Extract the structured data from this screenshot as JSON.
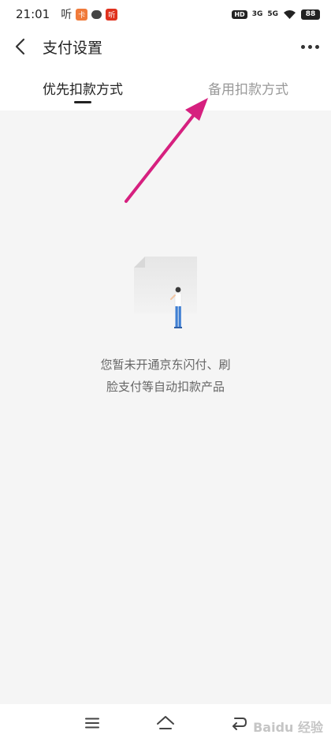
{
  "status_bar": {
    "time": "21:01",
    "app_icons": [
      "听",
      "卡",
      "消息",
      "听"
    ],
    "hd_label": "HD",
    "signal_1": "3G",
    "signal_2": "5G",
    "battery": "88"
  },
  "header": {
    "title": "支付设置",
    "back_icon": "chevron-left-icon",
    "more_icon": "more-dots-icon"
  },
  "tabs": [
    {
      "label": "优先扣款方式",
      "active": true
    },
    {
      "label": "备用扣款方式",
      "active": false
    }
  ],
  "empty_state": {
    "line1": "您暂未开通京东闪付、刷",
    "line2": "脸支付等自动扣款产品",
    "illustration": "empty-document-person-illustration"
  },
  "annotation": {
    "color": "#d6207f",
    "icon": "arrow-annotation"
  },
  "nav_bar": {
    "buttons": [
      "menu-icon",
      "home-icon",
      "back-icon"
    ]
  },
  "watermark": "Baidu 经验"
}
